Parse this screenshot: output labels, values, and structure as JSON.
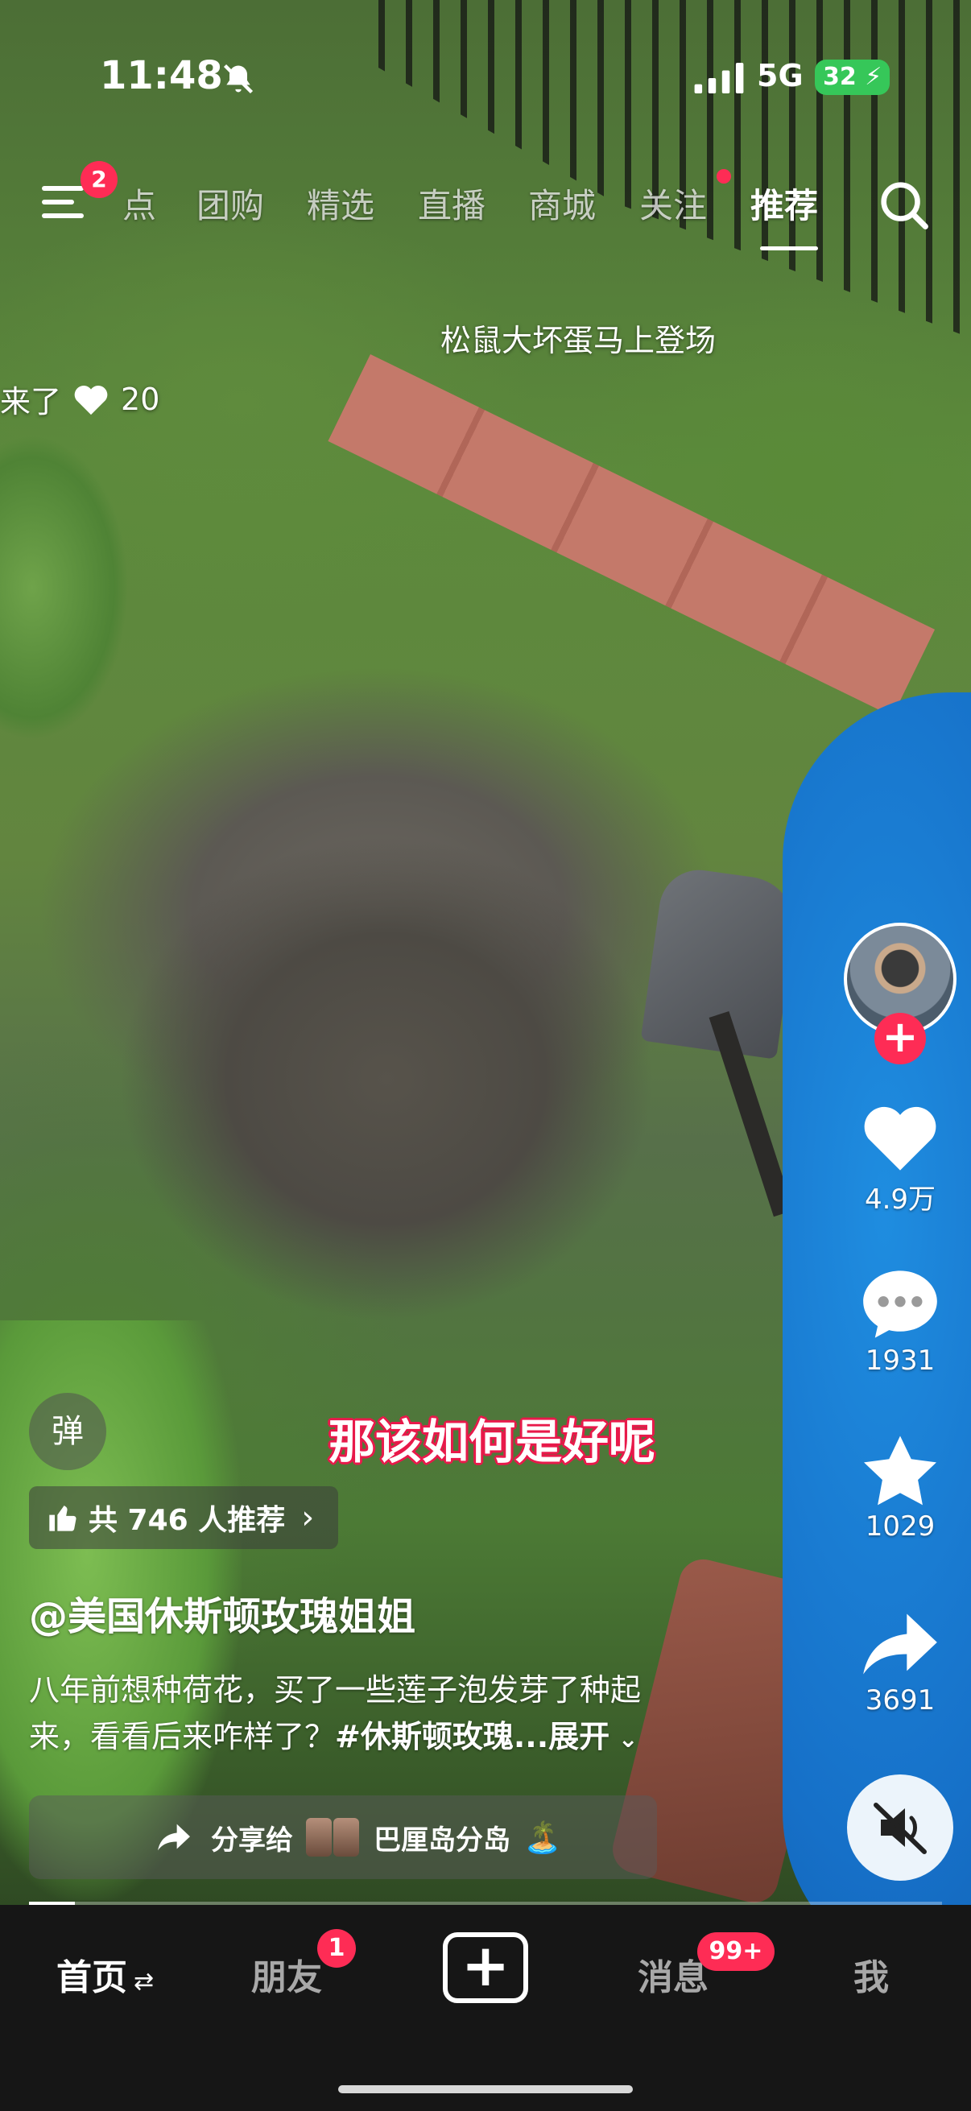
{
  "status_bar": {
    "time": "11:48",
    "network": "5G",
    "battery": "32"
  },
  "top_nav": {
    "menu_badge": "2",
    "tabs": [
      {
        "label": "点",
        "active": false
      },
      {
        "label": "团购",
        "active": false
      },
      {
        "label": "精选",
        "active": false
      },
      {
        "label": "直播",
        "active": false
      },
      {
        "label": "商城",
        "active": false
      },
      {
        "label": "关注",
        "active": false
      },
      {
        "label": "推荐",
        "active": true
      }
    ]
  },
  "video": {
    "caption": "松鼠大坏蛋马上登场",
    "danmaku": "来了",
    "danmaku_likes": "20",
    "subtitle": "那该如何是好呢",
    "progress": 0.05
  },
  "actions": {
    "likes": "4.9万",
    "comments": "1931",
    "favorites": "1029",
    "shares": "3691"
  },
  "info": {
    "danmu_button": "弹",
    "recommend": "共 746 人推荐",
    "author": "@美国休斯顿玫瑰姐姐",
    "description_line1": "八年前想种荷花，买了一些莲子泡发芽了种起",
    "description_line2": "来，看看后来咋样了？",
    "hashtag": "#休斯顿玫瑰...",
    "expand": "展开",
    "share_label": "分享给",
    "share_target": "巴厘岛分岛",
    "share_emoji": "🏝️"
  },
  "bottom_nav": {
    "home": "首页",
    "home_suffix": "⇄",
    "friends": "朋友",
    "friends_badge": "1",
    "create": "+",
    "messages": "消息",
    "messages_badge": "99+",
    "me": "我"
  },
  "colors": {
    "accent": "#fe2c55",
    "battery": "#36c759",
    "tarp": "#1670c8"
  }
}
